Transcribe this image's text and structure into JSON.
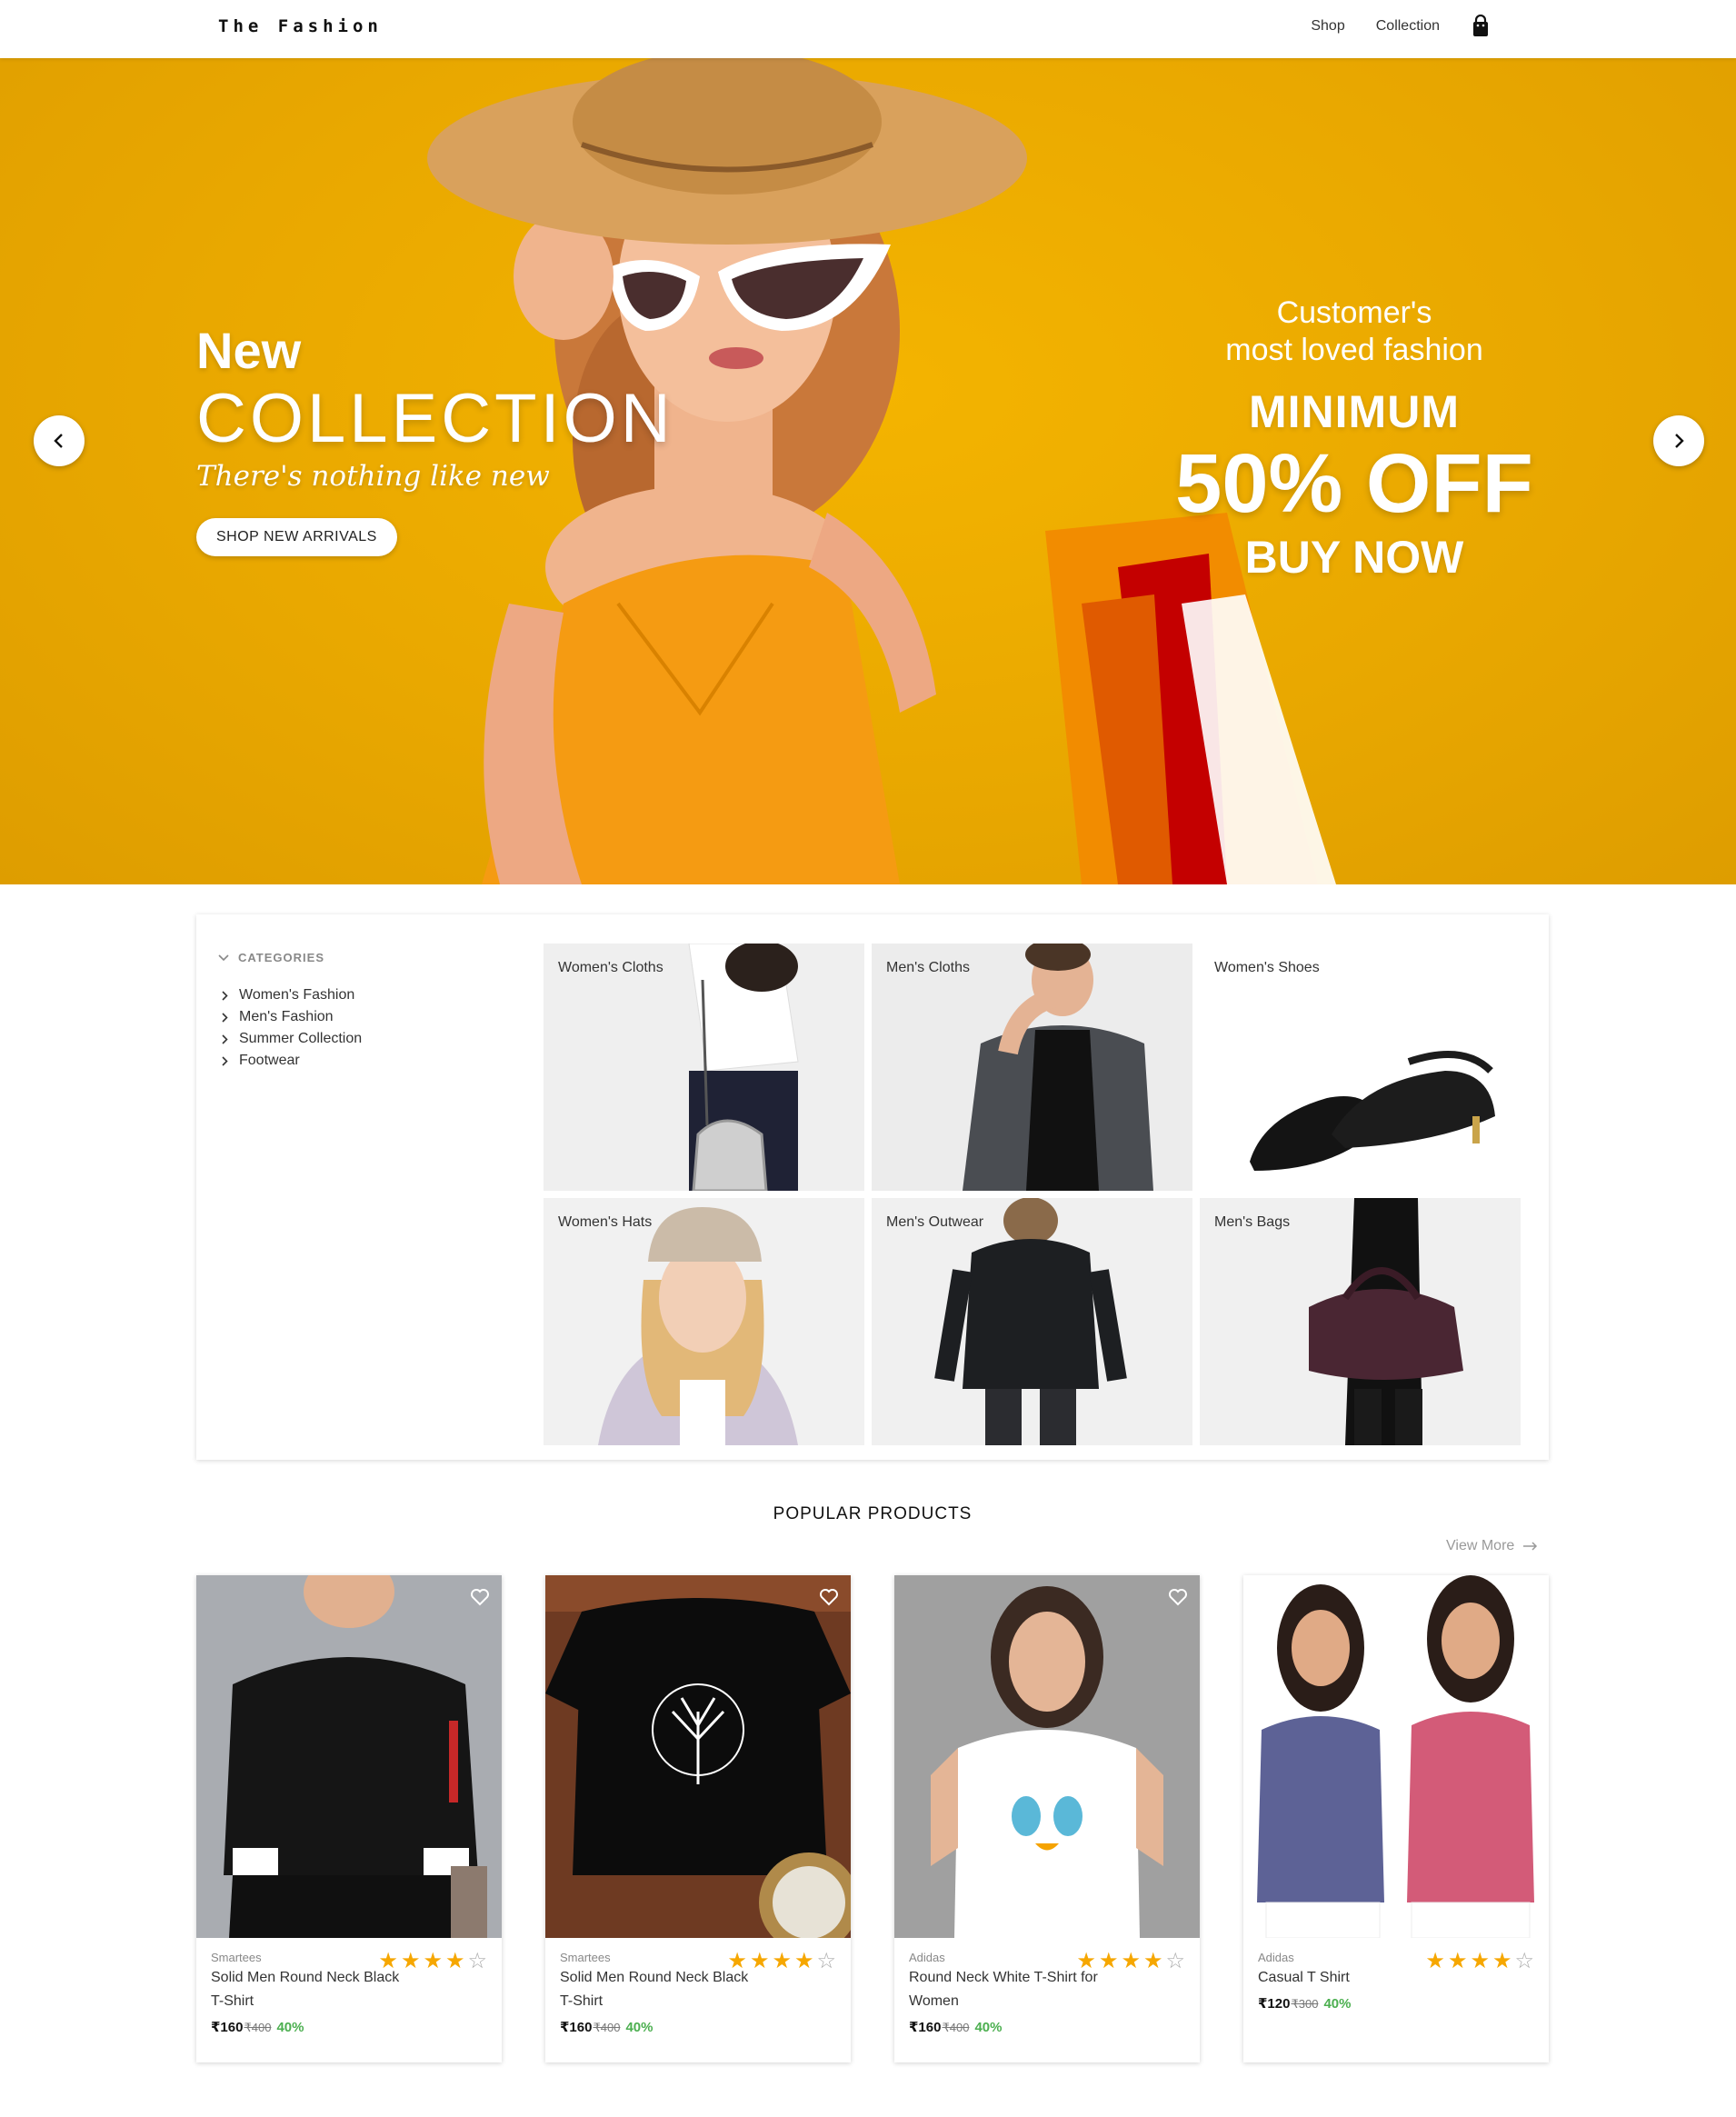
{
  "brand": "The Fashion",
  "nav": {
    "shop": "Shop",
    "collection": "Collection"
  },
  "hero": {
    "new": "New",
    "collection": "COLLECTION",
    "tagline": "There's nothing like new",
    "cta": "SHOP NEW ARRIVALS",
    "promo_line1": "Customer's",
    "promo_line2": "most loved fashion",
    "promo_minimum": "MINIMUM",
    "promo_off": "50% OFF",
    "promo_buy": "BUY NOW",
    "background_color": "#e9a800"
  },
  "categories": {
    "heading": "CATEGORIES",
    "items": [
      "Women's Fashion",
      "Men's Fashion",
      "Summer Collection",
      "Footwear"
    ],
    "tiles": [
      "Women's Cloths",
      "Men's Cloths",
      "Women's Shoes",
      "Women's Hats",
      "Men's Outwear",
      "Men's Bags"
    ]
  },
  "popular": {
    "title": "POPULAR PRODUCTS",
    "view_more": "View More",
    "products": [
      {
        "brand": "Smartees",
        "name": "Solid Men Round Neck Black T-Shirt",
        "price": "₹160",
        "original": "₹400",
        "discount": "40%",
        "rating": 4
      },
      {
        "brand": "Smartees",
        "name": "Solid Men Round Neck Black T-Shirt",
        "price": "₹160",
        "original": "₹400",
        "discount": "40%",
        "rating": 4
      },
      {
        "brand": "Adidas",
        "name": "Round Neck White T-Shirt for Women",
        "price": "₹160",
        "original": "₹400",
        "discount": "40%",
        "rating": 4
      },
      {
        "brand": "Adidas",
        "name": "Casual T Shirt",
        "price": "₹120",
        "original": "₹300",
        "discount": "40%",
        "rating": 4
      }
    ]
  },
  "colors": {
    "accent_star": "#f6a700",
    "discount_green": "#4caf50"
  }
}
